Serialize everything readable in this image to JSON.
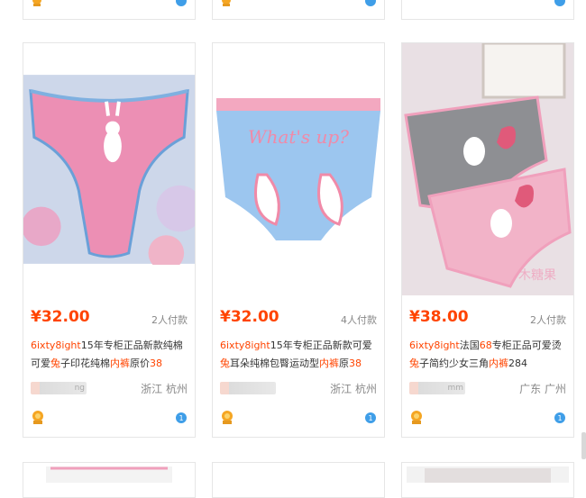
{
  "colors": {
    "price": "#ff4400",
    "highlight": "#ff4400",
    "border": "#e6e6e6"
  },
  "products": [
    {
      "price": "¥32.00",
      "sold": "2人付款",
      "title_parts": [
        {
          "t": "6ixty8ight",
          "hl": true
        },
        {
          "t": "15年专柜正品新款纯棉可爱",
          "hl": false
        },
        {
          "t": "兔",
          "hl": true
        },
        {
          "t": "子印花纯棉",
          "hl": false
        },
        {
          "t": "内裤",
          "hl": true
        },
        {
          "t": "原价",
          "hl": false
        },
        {
          "t": "38",
          "hl": true
        }
      ],
      "shop": "ng",
      "location": "浙江 杭州",
      "badge_icon": "gold-seller-badge-icon",
      "info_icon": "info-icon"
    },
    {
      "price": "¥32.00",
      "sold": "4人付款",
      "title_parts": [
        {
          "t": "6ixty8ight",
          "hl": true
        },
        {
          "t": "15年专柜正品新款可爱",
          "hl": false
        },
        {
          "t": "兔",
          "hl": true
        },
        {
          "t": "耳朵纯棉包臀运动型",
          "hl": false
        },
        {
          "t": "内裤",
          "hl": true
        },
        {
          "t": "原",
          "hl": false
        },
        {
          "t": "38",
          "hl": true
        }
      ],
      "shop": "",
      "location": "浙江 杭州",
      "badge_icon": "gold-seller-badge-icon",
      "info_icon": "info-icon"
    },
    {
      "price": "¥38.00",
      "sold": "2人付款",
      "title_parts": [
        {
          "t": "6ixty8ight",
          "hl": true
        },
        {
          "t": "法国",
          "hl": false
        },
        {
          "t": "68",
          "hl": true
        },
        {
          "t": "专柜正品可爱烫",
          "hl": false
        },
        {
          "t": "兔",
          "hl": true
        },
        {
          "t": "子简约少女三角",
          "hl": false
        },
        {
          "t": "内裤",
          "hl": true
        },
        {
          "t": "284",
          "hl": false
        }
      ],
      "shop": "mm",
      "location": "广东 广州",
      "badge_icon": "gold-seller-badge-icon",
      "info_icon": "info-icon"
    }
  ]
}
